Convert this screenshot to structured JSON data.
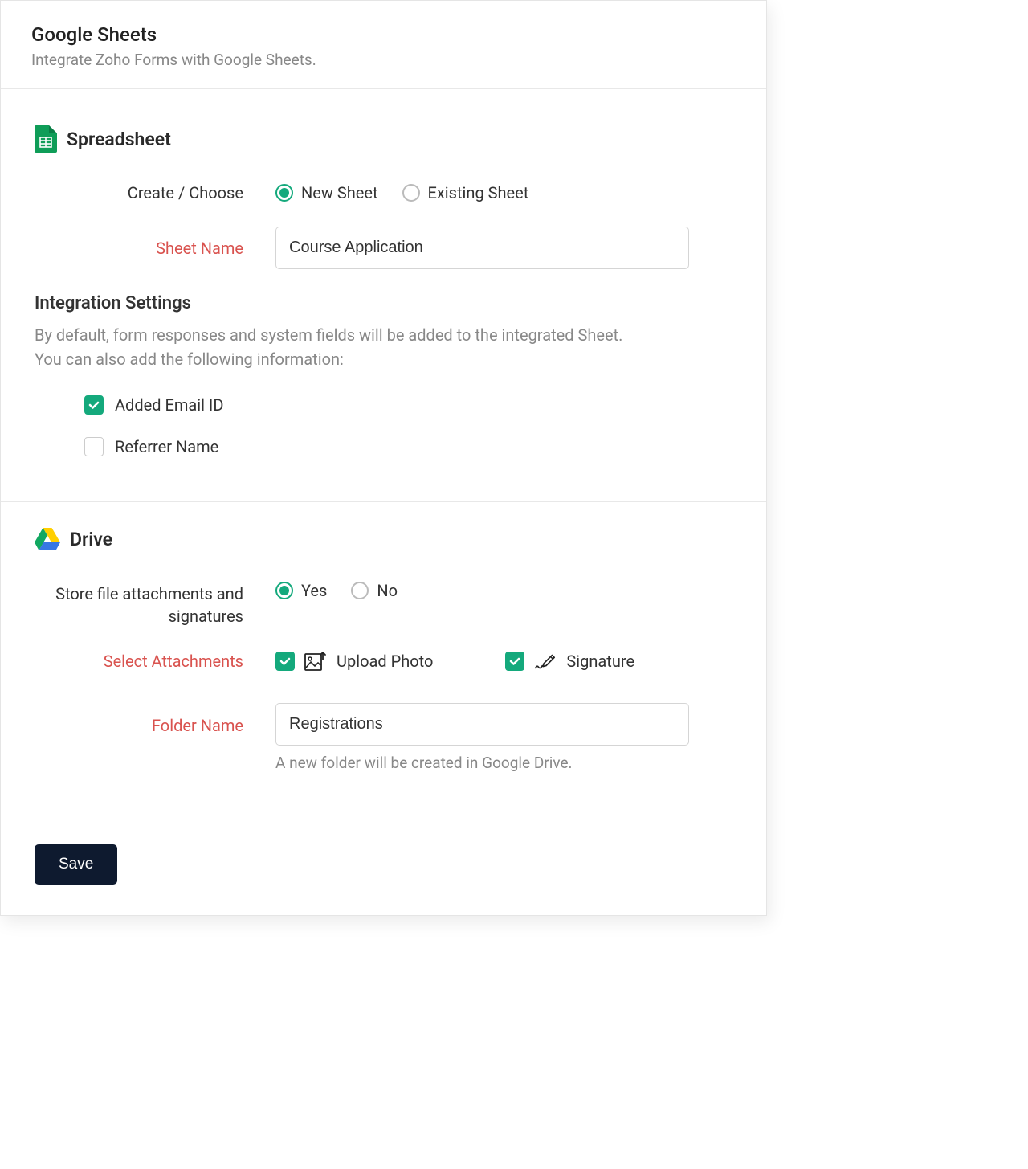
{
  "header": {
    "title": "Google Sheets",
    "subtitle": "Integrate Zoho Forms with Google Sheets."
  },
  "spreadsheet": {
    "heading": "Spreadsheet",
    "create_choose_label": "Create / Choose",
    "new_sheet": "New Sheet",
    "existing_sheet": "Existing Sheet",
    "sheet_name_label": "Sheet Name",
    "sheet_name_value": "Course Application"
  },
  "integration": {
    "heading": "Integration Settings",
    "desc_line1": "By default, form responses and system fields will be added to the integrated Sheet.",
    "desc_line2": "You can also add the following information:",
    "added_email_id": "Added Email ID",
    "referrer_name": "Referrer Name"
  },
  "drive": {
    "heading": "Drive",
    "store_label": "Store file attachments and signatures",
    "yes": "Yes",
    "no": "No",
    "select_attachments_label": "Select Attachments",
    "upload_photo": "Upload Photo",
    "signature": "Signature",
    "folder_name_label": "Folder Name",
    "folder_name_value": "Registrations",
    "folder_help": "A new folder will be created in Google Drive."
  },
  "footer": {
    "save": "Save"
  }
}
